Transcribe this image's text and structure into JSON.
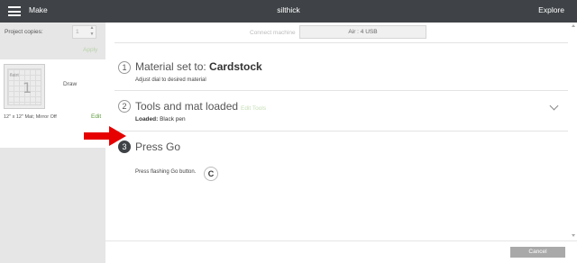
{
  "header": {
    "make_label": "Make",
    "title": "silthick",
    "explore_label": "Explore"
  },
  "sidebar": {
    "copies_label": "Project copies:",
    "copies_value": "1",
    "apply_label": "Apply",
    "mat": {
      "draw_label": "Draw",
      "info": "12\" x 12\" Mat; Mirror Off",
      "edit_label": "Edit",
      "thumb_glyph": "1",
      "thumb_text": "flatrt"
    }
  },
  "main": {
    "connect_label": "Connect machine",
    "machine_value": "Air : 4 USB",
    "steps": [
      {
        "number": "1",
        "title_prefix": "Material set to: ",
        "title_bold": "Cardstock",
        "subtitle": "Adjust dial to desired material"
      },
      {
        "number": "2",
        "title": "Tools and mat loaded",
        "edit_label": "Edit Tools",
        "loaded_label": "Loaded:",
        "loaded_value": "Black pen"
      },
      {
        "number": "3",
        "title": "Press Go",
        "subtitle": "Press flashing Go button.",
        "go_glyph": "C"
      }
    ]
  },
  "footer": {
    "cancel_label": "Cancel"
  },
  "colors": {
    "header_bg": "#3f4347",
    "sidebar_bg": "#e6e6e6",
    "accent_green": "#5a9a3a",
    "arrow_red": "#e60000"
  },
  "icons": [
    "menu-icon",
    "chevron-down-icon",
    "go-icon",
    "red-arrow-icon"
  ]
}
